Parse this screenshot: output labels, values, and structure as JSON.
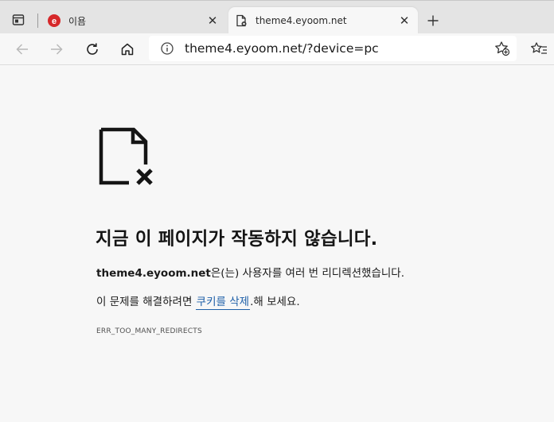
{
  "tabs": [
    {
      "title": "이욤",
      "close": "✕",
      "favicon_color": "#d6282a",
      "favicon_letter": "e"
    },
    {
      "title": "theme4.eyoom.net",
      "close": "✕"
    }
  ],
  "newtab_icon": "plus-icon",
  "address_bar": {
    "url": "theme4.eyoom.net/?device=pc"
  },
  "error": {
    "title": "지금 이 페이지가 작동하지 않습니다.",
    "host": "theme4.eyoom.net",
    "message_suffix": "은(는) 사용자를 여러 번 리디렉션했습니다.",
    "fix_prefix": "이 문제를 해결하려면 ",
    "fix_link": "쿠키를 삭제",
    "fix_suffix": ".해 보세요.",
    "code": "ERR_TOO_MANY_REDIRECTS"
  },
  "colors": {
    "link": "#1e5fa8",
    "page_bg": "#f7f7f7",
    "tabstrip_bg": "#e4e4e4"
  }
}
